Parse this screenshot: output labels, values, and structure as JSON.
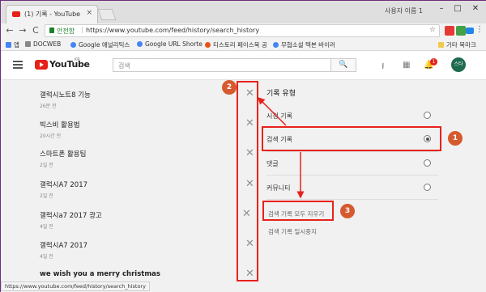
{
  "browser": {
    "tab_title": "(1) 기록 - YouTube",
    "tab_close": "×",
    "user_label": "사용자 이름 1",
    "win_min": "–",
    "win_max": "□",
    "win_close": "✕",
    "back": "←",
    "forward": "→",
    "reload": "C",
    "secure_label": "안전함",
    "url": "https://www.youtube.com/feed/history/search_history",
    "star": "☆",
    "menu": "⋮"
  },
  "bookmarks": {
    "apps": "앱",
    "items": [
      "DOCWEB",
      "Google 애널리틱스",
      "Google URL Shorte",
      "티스토리 페이스북 공",
      "무협소설 텍본 바이러"
    ],
    "other": "기타 북마크"
  },
  "youtube": {
    "logo_text": "YouTube",
    "country": "KR",
    "search_placeholder": "검색",
    "search_btn": "🔍",
    "upload_icon": "⭱",
    "apps_icon": "▦",
    "bell_icon": "🔔",
    "notif_count": "1",
    "avatar_text": "스타"
  },
  "history": [
    {
      "term": "갤럭시노트8 기능",
      "time": "26분 전"
    },
    {
      "term": "빅스비 활용법",
      "time": "20시간 전"
    },
    {
      "term": "스마트폰 활용팁",
      "time": "2일 전"
    },
    {
      "term": "갤럭시A7 2017",
      "time": "2일 전"
    },
    {
      "term": "갤럭시a7 2017 광고",
      "time": "4일 전"
    },
    {
      "term": "갤럭시A7 2017",
      "time": "4일 전"
    },
    {
      "term": "we wish you a merry christmas",
      "time": ""
    }
  ],
  "close_glyph": "✕",
  "panel": {
    "heading": "기록 유형",
    "options": [
      {
        "label": "시청 기록",
        "selected": false
      },
      {
        "label": "검색 기록",
        "selected": true
      },
      {
        "label": "댓글",
        "selected": false
      },
      {
        "label": "커뮤니티",
        "selected": false
      }
    ],
    "clear_all": "검색 기록 모두 지우기",
    "pause": "검색 기록 일시중지"
  },
  "annotations": {
    "c1": "1",
    "c2": "2",
    "c3": "3"
  },
  "status_url": "https://www.youtube.com/feed/history/search_history",
  "colors": {
    "accent_red": "#e8211c",
    "circle_orange": "#d65a2f",
    "yt_red": "#e62117",
    "secure_green": "#1b7f2a"
  }
}
